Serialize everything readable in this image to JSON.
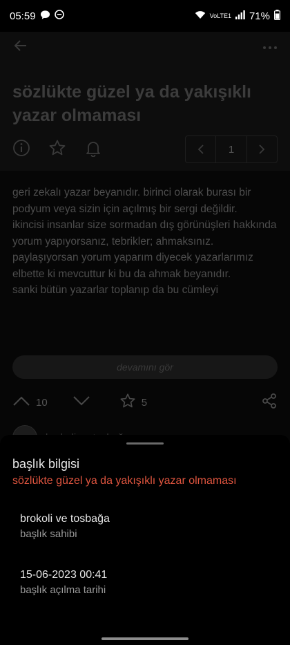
{
  "status_bar": {
    "time": "05:59",
    "network": "VoLTE1",
    "battery": "71%"
  },
  "topic": {
    "title": "sözlükte güzel ya da yakışıklı yazar olmaması",
    "page_number": "1"
  },
  "entry": {
    "text": "geri zekalı yazar beyanıdır. birinci olarak burası bir podyum veya sizin için açılmış bir sergi değildir.\nikincisi insanlar size sormadan dış görünüşleri hakkında yorum yapıyorsanız, tebrikler; ahmaksınız.\npaylaşıyorsan yorum yaparım diyecek yazarlarımız elbette ki mevcuttur ki bu da ahmak beyanıdır.\nsanki bütün yazarlar toplanıp da bu cümleyi",
    "more_label": "devamını gör",
    "upvotes": "10",
    "favorites": "5",
    "author": "brokoli ve tosbağa"
  },
  "sheet": {
    "heading": "başlık bilgisi",
    "topic_title": "sözlükte güzel ya da yakışıklı yazar olmaması",
    "owner_value": "brokoli ve tosbağa",
    "owner_label": "başlık sahibi",
    "date_value": "15-06-2023 00:41",
    "date_label": "başlık açılma tarihi"
  },
  "colors": {
    "accent": "#e0553f",
    "background": "#000000"
  }
}
